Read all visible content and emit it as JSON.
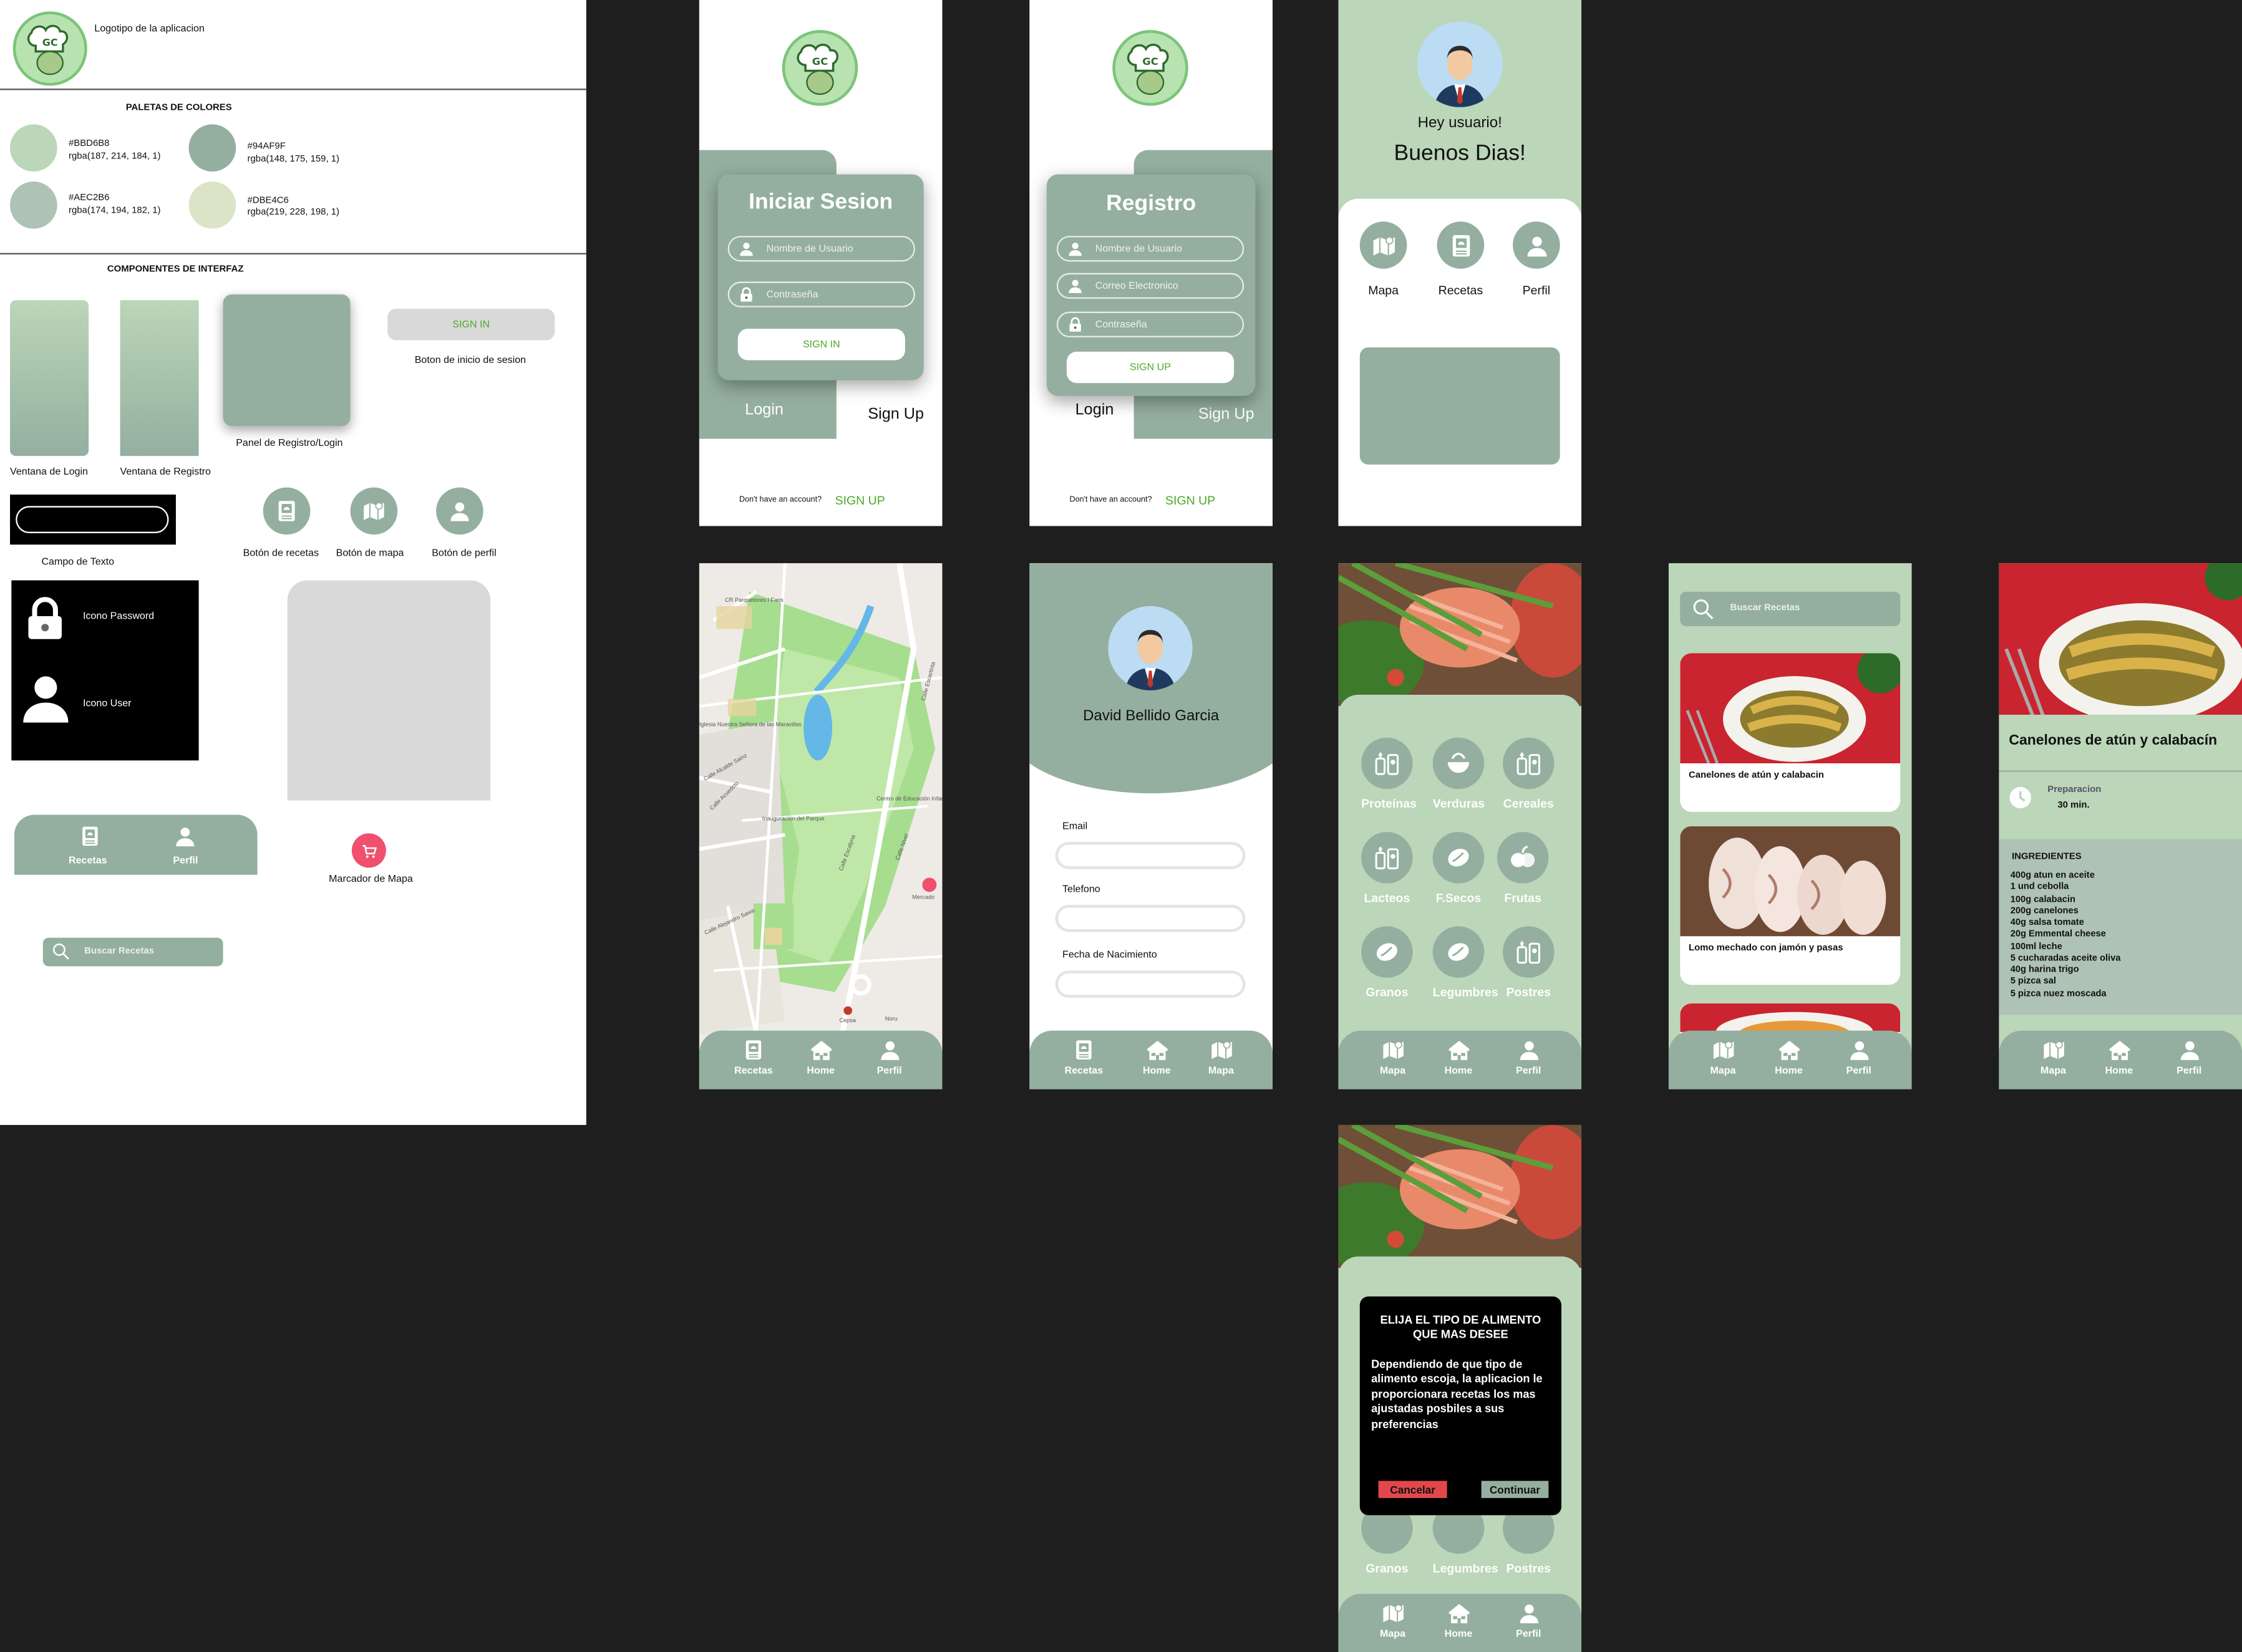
{
  "style": {
    "logo_caption": "Logotipo de la aplicacion",
    "palette_title": "PALETAS DE COLORES",
    "palette": [
      {
        "hex_label": "#BBD6B8",
        "rgba": "rgba(187, 214, 184, 1)",
        "color": "#BBD6B8"
      },
      {
        "hex_label": "#94AF9F",
        "rgba": "rgba(148, 175, 159, 1)",
        "color": "#94AF9F"
      },
      {
        "hex_label": "#AEC2B6",
        "rgba": "rgba(174, 194, 182, 1)",
        "color": "#AEC2B6"
      },
      {
        "hex_label": "#DBE4C6",
        "rgba": "rgba(219, 228, 198, 1)",
        "color": "#DBE4C6"
      }
    ],
    "components_title": "COMPONENTES DE INTERFAZ",
    "login_window": "Ventana de Login",
    "register_window": "Ventana de Registro",
    "panel": "Panel de Registro/Login",
    "signin_button": "SIGN IN",
    "signin_caption": "Boton de inicio de sesion",
    "text_field": "Campo de Texto",
    "btn_recetas": "Botón de recetas",
    "btn_mapa": "Botón de mapa",
    "btn_perfil": "Botón de perfil",
    "icon_password": "Icono Password",
    "icon_user": "Icono User",
    "nav_recetas": "Recetas",
    "nav_perfil": "Perfil",
    "map_marker": "Marcador de Mapa",
    "search_placeholder": "Buscar Recetas"
  },
  "login": {
    "title": "Iniciar Sesion",
    "username": "Nombre de Usuario",
    "password": "Contraseña",
    "button": "SIGN IN",
    "tab_login": "Login",
    "tab_signup": "Sign Up",
    "no_account": "Don't have an account?",
    "signup_link": "SIGN UP"
  },
  "register": {
    "title": "Registro",
    "username": "Nombre de Usuario",
    "email": "Correo Electronico",
    "password": "Contraseña",
    "button": "SIGN UP",
    "tab_login": "Login",
    "tab_signup": "Sign Up",
    "no_account": "Don't have an account?",
    "signup_link": "SIGN UP"
  },
  "home": {
    "greeting": "Hey usuario!",
    "headline": "Buenos Dias!",
    "menu": [
      "Mapa",
      "Recetas",
      "Perfil"
    ]
  },
  "map": {
    "labels": [
      "CR Parquetores I Faos",
      "Iglesia Nuestra Señora de las Maravillas",
      "Calle Alcalde Sainz",
      "Calle Acuedcto",
      "Inauguración del Parque",
      "Calle Alejandro Sawa",
      "Centro de Educación Infantil Primario",
      "Calle Escalyna",
      "Calle Nivel",
      "Mercado",
      "Cepsa",
      "Noru",
      "Calle Escartinta"
    ],
    "nav": [
      "Recetas",
      "Home",
      "Perfil"
    ]
  },
  "profile": {
    "name": "David Bellido Garcia",
    "fields": [
      "Email",
      "Telefono",
      "Fecha de Nacimiento"
    ],
    "nav": [
      "Recetas",
      "Home",
      "Mapa"
    ]
  },
  "categories": {
    "items": [
      "Proteínas",
      "Verduras",
      "Cereales",
      "Lacteos",
      "F.Secos",
      "Frutas",
      "Granos",
      "Legumbres",
      "Postres"
    ],
    "nav": [
      "Mapa",
      "Home",
      "Perfil"
    ]
  },
  "recipes": {
    "search_placeholder": "Buscar Recetas",
    "items": [
      "Canelones de atún y calabacin",
      "Lomo mechado con jamón y pasas"
    ],
    "nav": [
      "Mapa",
      "Home",
      "Perfil"
    ]
  },
  "detail": {
    "title": "Canelones de atún y calabacín",
    "prep_label": "Preparacion",
    "prep_time": "30 min.",
    "ingredients_title": "INGREDIENTES",
    "ingredients": [
      "400g atun en aceite",
      "1 und cebolla",
      "100g calabacin",
      "200g canelones",
      "40g salsa tomate",
      "20g Emmental cheese",
      "100ml leche",
      "5 cucharadas aceite oliva",
      "40g harina trigo",
      "5 pizca sal",
      "5 pizca nuez moscada"
    ],
    "nav": [
      "Mapa",
      "Home",
      "Perfil"
    ]
  },
  "dialog": {
    "title": "ELIJA EL TIPO DE ALIMENTO QUE MAS DESEE",
    "body": "Dependiendo de que tipo de alimento escoja, la aplicacion le proporcionara recetas los mas ajustadas posbiles a sus preferencias",
    "cancel": "Cancelar",
    "continue": "Continuar",
    "visible_categories": [
      "Granos",
      "Legumbres",
      "Postres"
    ],
    "nav": [
      "Mapa",
      "Home",
      "Perfil"
    ]
  },
  "colors": {
    "green": "#bbd6b8",
    "dark": "#94af9f",
    "accent": "#4fa82b",
    "marker": "#f0506e"
  }
}
